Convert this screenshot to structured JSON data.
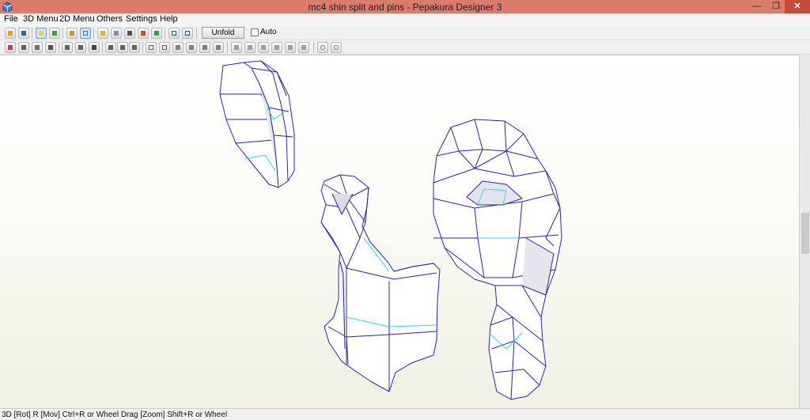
{
  "window": {
    "title": "mc4 shin split and pins - Pepakura Designer 3"
  },
  "menu": [
    "File",
    "3D Menu",
    "2D Menu",
    "Others",
    "Settings",
    "Help"
  ],
  "toolbar": {
    "unfold_label": "Unfold",
    "auto_label": "Auto",
    "auto_checked": false,
    "icons_row1": [
      "open-icon",
      "save-icon",
      "light-icon",
      "texture-icon",
      "box-icon",
      "wireframe-icon",
      "edit-icon",
      "cylinder-icon",
      "move-icon",
      "cube-icon",
      "frame-icon",
      "layout-icon",
      "page-icon"
    ],
    "icons_row2": [
      "select-icon",
      "pointer-icon",
      "grid-icon",
      "layers-icon",
      "flap-icon",
      "fold-icon",
      "print-icon",
      "join-icon",
      "rotate-icon",
      "pin-icon",
      "align-icon",
      "grid2-icon",
      "tile-icon",
      "copy-icon",
      "align-left-icon",
      "align-center-icon",
      "align-right-icon",
      "distribute-icon",
      "zoom-in-icon",
      "zoom-out-icon"
    ]
  },
  "status": {
    "text": "3D [Rot] R [Mov] Ctrl+R or Wheel Drag [Zoom] Shift+R or Wheel"
  },
  "colors": {
    "titlebar": "#db7b6b",
    "edge": "#2a24a8",
    "fold": "#33d4e8"
  }
}
